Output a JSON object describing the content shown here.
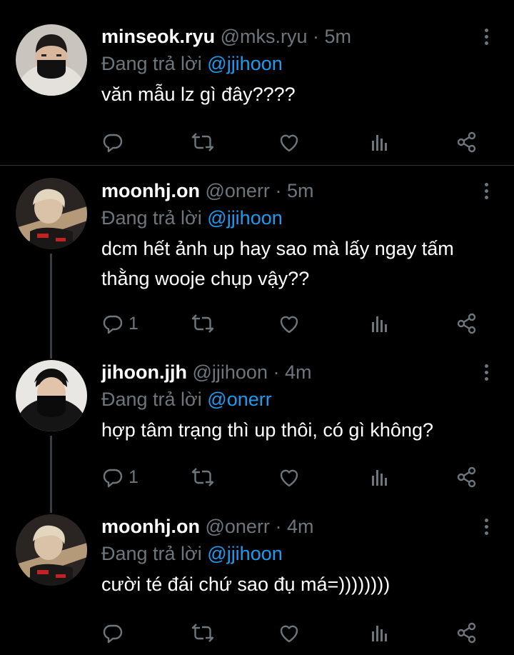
{
  "tweets": [
    {
      "display_name": "minseok.ryu",
      "handle": "@mks.ryu",
      "time": "5m",
      "reply_prefix": "Đang trả lời",
      "reply_to": "@jjihoon",
      "text": "văn mẫu lz gì đây????",
      "reply_count": "",
      "avatar_icon": "avatar-masked-hood"
    },
    {
      "display_name": "moonhj.on",
      "handle": "@onerr",
      "time": "5m",
      "reply_prefix": "Đang trả lời",
      "reply_to": "@jjihoon",
      "text": "dcm hết ảnh up hay sao mà lấy ngay tấm thằng wooje chụp vậy??",
      "reply_count": "1",
      "avatar_icon": "avatar-blonde-seatbelt"
    },
    {
      "display_name": "jihoon.jjh",
      "handle": "@jjihoon",
      "time": "4m",
      "reply_prefix": "Đang trả lời",
      "reply_to": "@onerr",
      "text": "hợp tâm trạng thì up thôi, có gì không?",
      "reply_count": "1",
      "avatar_icon": "avatar-masked-dark"
    },
    {
      "display_name": "moonhj.on",
      "handle": "@onerr",
      "time": "4m",
      "reply_prefix": "Đang trả lời",
      "reply_to": "@jjihoon",
      "text": "cười té đái chứ sao đụ má=))))))))",
      "reply_count": "",
      "avatar_icon": "avatar-blonde-seatbelt"
    }
  ],
  "separator": "·",
  "colors": {
    "background": "#000000",
    "muted": "#6e767d",
    "link": "#1d9bf0",
    "divider": "#2f3336"
  },
  "action_icons": [
    "reply-icon",
    "retweet-icon",
    "like-icon",
    "analytics-icon",
    "share-icon"
  ]
}
